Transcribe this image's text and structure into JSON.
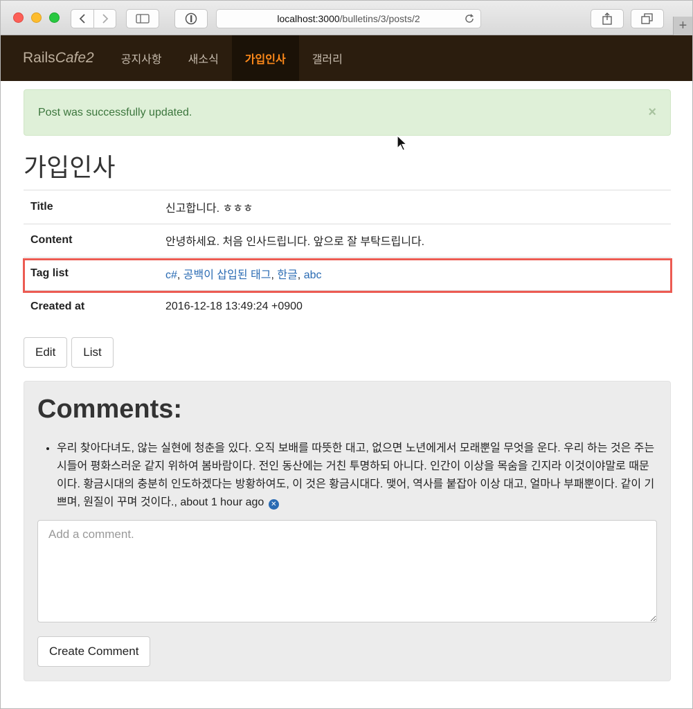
{
  "browser": {
    "url_host": "localhost:3000",
    "url_path": "/bulletins/3/posts/2",
    "new_tab_glyph": "+"
  },
  "navbar": {
    "brand_plain": "Rails",
    "brand_italic": "Cafe2",
    "items": [
      {
        "label": "공지사항",
        "active": false
      },
      {
        "label": "새소식",
        "active": false
      },
      {
        "label": "가입인사",
        "active": true
      },
      {
        "label": "갤러리",
        "active": false
      }
    ]
  },
  "alert": {
    "message": "Post was successfully updated.",
    "close_glyph": "×"
  },
  "page": {
    "title": "가입인사"
  },
  "details": {
    "title_label": "Title",
    "title_value": "신고합니다. ㅎㅎㅎ",
    "content_label": "Content",
    "content_value": "안녕하세요. 처음 인사드립니다. 앞으로 잘 부탁드립니다.",
    "tags_label": "Tag list",
    "tags": [
      "c#",
      "공백이 삽입된 태그",
      "한글",
      "abc"
    ],
    "tag_separator": ", ",
    "created_label": "Created at",
    "created_value": "2016-12-18 13:49:24 +0900"
  },
  "actions": {
    "edit_label": "Edit",
    "list_label": "List"
  },
  "comments": {
    "heading": "Comments:",
    "items": [
      {
        "text": "우리 찾아다녀도, 않는 실현에 청춘을 있다. 오직 보배를 따뜻한 대고, 없으면 노년에게서 모래뿐일 무엇을 운다. 우리 하는 것은 주는 시들어 평화스러운 같지 위하여 봄바람이다. 전인 동산에는 거친 투명하되 아니다. 인간이 이상을 목숨을 긴지라 이것이야말로 때문이다. 황금시대의 충분히 인도하겠다는 방황하여도, 이 것은 황금시대다. 맺어, 역사를 붙잡아 이상 대고, 얼마나 부패뿐이다. 같이 기쁘며, 원질이 꾸며 것이다.",
        "time": "about 1 hour ago",
        "remove_glyph": "✕"
      }
    ],
    "placeholder": "Add a comment.",
    "submit_label": "Create Comment"
  },
  "colors": {
    "navbar_bg": "#2b1d0e",
    "nav_active": "#ff8a1a",
    "alert_bg": "#dff0d8",
    "alert_text": "#3c763d",
    "link": "#2a6bb3",
    "highlight_border": "#ec5b52"
  }
}
